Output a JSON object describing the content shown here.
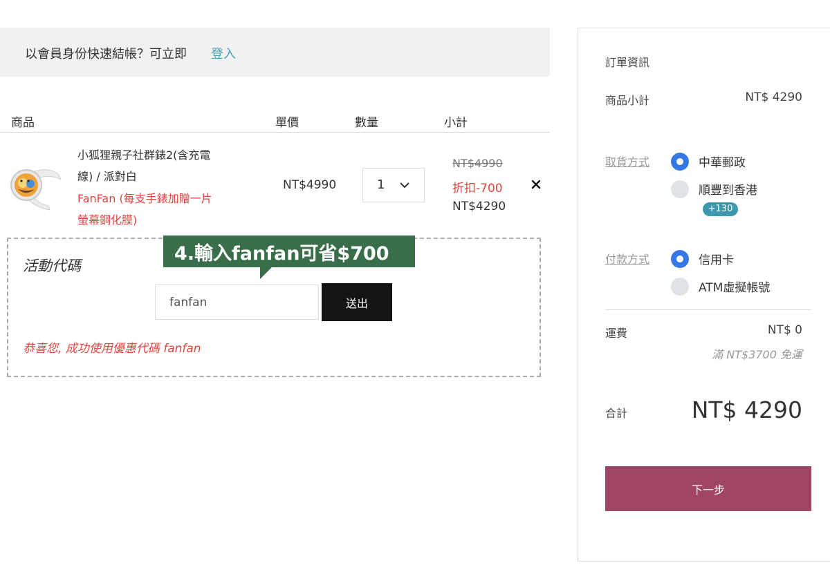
{
  "login_banner": {
    "prompt": "以會員身份快速結帳？可立即",
    "link": "登入"
  },
  "cart": {
    "headers": {
      "product": "商品",
      "unit_price": "單價",
      "quantity": "數量",
      "subtotal": "小計"
    },
    "item": {
      "name_lines": [
        "小狐狸親子社群錶2(含充電",
        "線) / 派對白"
      ],
      "variant_lines": [
        "FanFan (每支手錶加贈一片",
        "螢幕鋼化膜)"
      ],
      "unit_price": "NT$4990",
      "quantity": "1",
      "original_subtotal": "NT$4990",
      "discount": "折扣-700",
      "final_subtotal": "NT$4290"
    }
  },
  "promo": {
    "title": "活動代碼",
    "input_value": "fanfan",
    "submit_label": "送出",
    "success_message": "恭喜您, 成功使用優惠代碼 fanfan"
  },
  "annotation": {
    "text": "4.輸入fanfan可省$700",
    "color": "#3a6e4a"
  },
  "summary": {
    "title": "訂單資訊",
    "subtotal_label": "商品小計",
    "subtotal_value": "NT$ 4290",
    "pickup_label": "取貨方式",
    "pickup_options": [
      {
        "label": "中華郵政",
        "selected": true
      },
      {
        "label": "順豐到香港",
        "selected": false
      }
    ],
    "points_badge": "+130",
    "payment_label": "付款方式",
    "payment_options": [
      {
        "label": "信用卡",
        "selected": true
      },
      {
        "label": "ATM虛擬帳號",
        "selected": false
      }
    ],
    "shipping_label": "運費",
    "shipping_value": "NT$ 0",
    "free_shipping_note": "滿 NT$3700 免運",
    "total_label": "合計",
    "total_value": "NT$ 4290",
    "next_button": "下一步"
  },
  "colors": {
    "accent_link": "#4aa3b5",
    "discount_red": "#e0463f",
    "radio_selected": "#3578e5",
    "next_button": "#a04565",
    "badge": "#3c98ad"
  }
}
